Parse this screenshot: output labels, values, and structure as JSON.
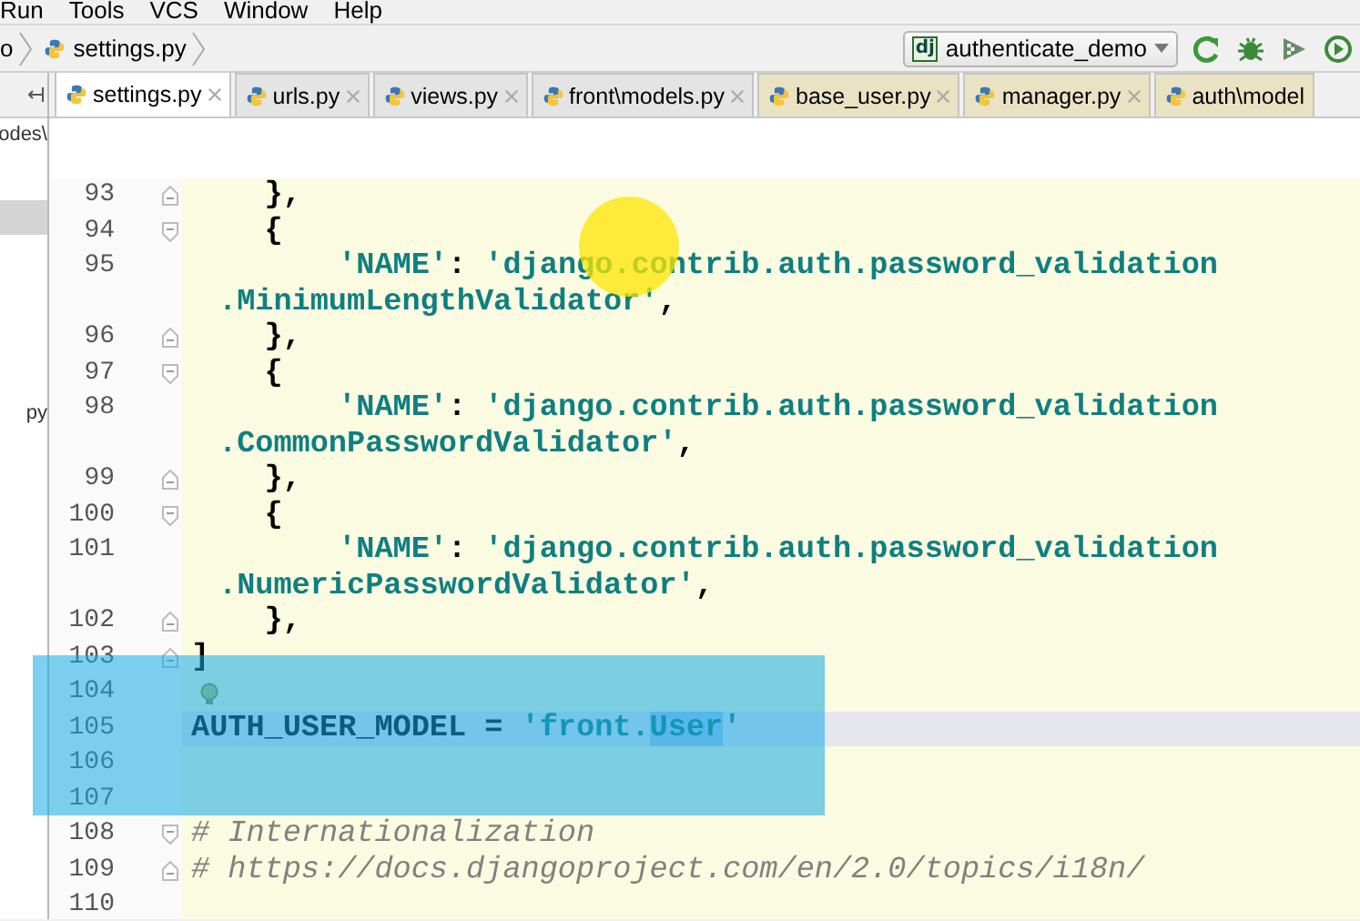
{
  "menu_bar": {
    "items": [
      "Run",
      "Tools",
      "VCS",
      "Window",
      "Help"
    ]
  },
  "nav_bar": {
    "breadcrumbs": [
      "o",
      "settings.py"
    ],
    "run_config_icon": "dj",
    "run_config": "authenticate_demo"
  },
  "project_panel": {
    "items": [
      {
        "label": "odes\\",
        "selected": false
      },
      {
        "selected": true
      },
      {
        "label": "py",
        "selected": false
      }
    ]
  },
  "tabs": [
    {
      "label": "settings.py",
      "selected": true,
      "kind": "project"
    },
    {
      "label": "urls.py",
      "selected": false,
      "kind": "project"
    },
    {
      "label": "views.py",
      "selected": false,
      "kind": "project"
    },
    {
      "label": "front\\models.py",
      "selected": false,
      "kind": "project"
    },
    {
      "label": "base_user.py",
      "selected": false,
      "kind": "library"
    },
    {
      "label": "manager.py",
      "selected": false,
      "kind": "library"
    },
    {
      "label": "auth\\model",
      "selected": false,
      "kind": "library"
    }
  ],
  "editor": {
    "rows": [
      {
        "number": "93",
        "fold_start": false,
        "fold_end": true,
        "current": false,
        "bulb": false,
        "tokens": [
          {
            "kind": "plain",
            "text": "    },"
          }
        ]
      },
      {
        "number": "94",
        "fold_start": true,
        "fold_end": false,
        "current": false,
        "bulb": false,
        "tokens": [
          {
            "kind": "plain",
            "text": "    {"
          }
        ]
      },
      {
        "number": "95",
        "fold_start": false,
        "fold_end": false,
        "current": false,
        "bulb": false,
        "tokens": [
          {
            "kind": "string",
            "text": "        'NAME'"
          },
          {
            "kind": "plain",
            "text": ": "
          },
          {
            "kind": "string",
            "text": "'django.contrib.auth.password_validation"
          }
        ]
      },
      {
        "fold_start": false,
        "fold_end": false,
        "current": false,
        "bulb": false,
        "tokens": [
          {
            "kind": "string",
            "text": ".MinimumLengthValidator'"
          },
          {
            "kind": "plain",
            "text": ","
          }
        ]
      },
      {
        "number": "96",
        "fold_start": false,
        "fold_end": true,
        "current": false,
        "bulb": false,
        "tokens": [
          {
            "kind": "plain",
            "text": "    },"
          }
        ]
      },
      {
        "number": "97",
        "fold_start": true,
        "fold_end": false,
        "current": false,
        "bulb": false,
        "tokens": [
          {
            "kind": "plain",
            "text": "    {"
          }
        ]
      },
      {
        "number": "98",
        "fold_start": false,
        "fold_end": false,
        "current": false,
        "bulb": false,
        "tokens": [
          {
            "kind": "string",
            "text": "        'NAME'"
          },
          {
            "kind": "plain",
            "text": ": "
          },
          {
            "kind": "string",
            "text": "'django.contrib.auth.password_validation"
          }
        ]
      },
      {
        "fold_start": false,
        "fold_end": false,
        "current": false,
        "bulb": false,
        "tokens": [
          {
            "kind": "string",
            "text": ".CommonPasswordValidator'"
          },
          {
            "kind": "plain",
            "text": ","
          }
        ]
      },
      {
        "number": "99",
        "fold_start": false,
        "fold_end": true,
        "current": false,
        "bulb": false,
        "tokens": [
          {
            "kind": "plain",
            "text": "    },"
          }
        ]
      },
      {
        "number": "100",
        "fold_start": true,
        "fold_end": false,
        "current": false,
        "bulb": false,
        "tokens": [
          {
            "kind": "plain",
            "text": "    {"
          }
        ]
      },
      {
        "number": "101",
        "fold_start": false,
        "fold_end": false,
        "current": false,
        "bulb": false,
        "tokens": [
          {
            "kind": "string",
            "text": "        'NAME'"
          },
          {
            "kind": "plain",
            "text": ": "
          },
          {
            "kind": "string",
            "text": "'django.contrib.auth.password_validation"
          }
        ]
      },
      {
        "fold_start": false,
        "fold_end": false,
        "current": false,
        "bulb": false,
        "tokens": [
          {
            "kind": "string",
            "text": ".NumericPasswordValidator'"
          },
          {
            "kind": "plain",
            "text": ","
          }
        ]
      },
      {
        "number": "102",
        "fold_start": false,
        "fold_end": true,
        "current": false,
        "bulb": false,
        "tokens": [
          {
            "kind": "plain",
            "text": "    },"
          }
        ]
      },
      {
        "number": "103",
        "fold_start": false,
        "fold_end": true,
        "current": false,
        "bulb": false,
        "tokens": [
          {
            "kind": "plain",
            "text": "]"
          }
        ]
      },
      {
        "number": "104",
        "fold_start": false,
        "fold_end": false,
        "current": false,
        "bulb": true
      },
      {
        "number": "105",
        "fold_start": false,
        "fold_end": false,
        "current": true,
        "bulb": false,
        "tokens": [
          {
            "kind": "plain",
            "text": "AUTH_USER_MODEL = "
          },
          {
            "kind": "string",
            "text": "'front."
          },
          {
            "kind": "selection",
            "text": "User"
          },
          {
            "kind": "string",
            "text": "'"
          }
        ]
      },
      {
        "number": "106",
        "fold_start": false,
        "fold_end": false,
        "current": false,
        "bulb": false
      },
      {
        "number": "107",
        "fold_start": false,
        "fold_end": false,
        "current": false,
        "bulb": false
      },
      {
        "number": "108",
        "fold_start": true,
        "fold_end": false,
        "current": false,
        "bulb": false,
        "tokens": [
          {
            "kind": "comment",
            "text": "# Internationalization"
          }
        ]
      },
      {
        "number": "109",
        "fold_start": false,
        "fold_end": true,
        "current": false,
        "bulb": false,
        "tokens": [
          {
            "kind": "comment",
            "text": "# https://docs.djangoproject.com/en/2.0/topics/i18n/"
          }
        ]
      },
      {
        "number": "110",
        "fold_start": false,
        "fold_end": false,
        "current": false,
        "bulb": false
      }
    ]
  }
}
